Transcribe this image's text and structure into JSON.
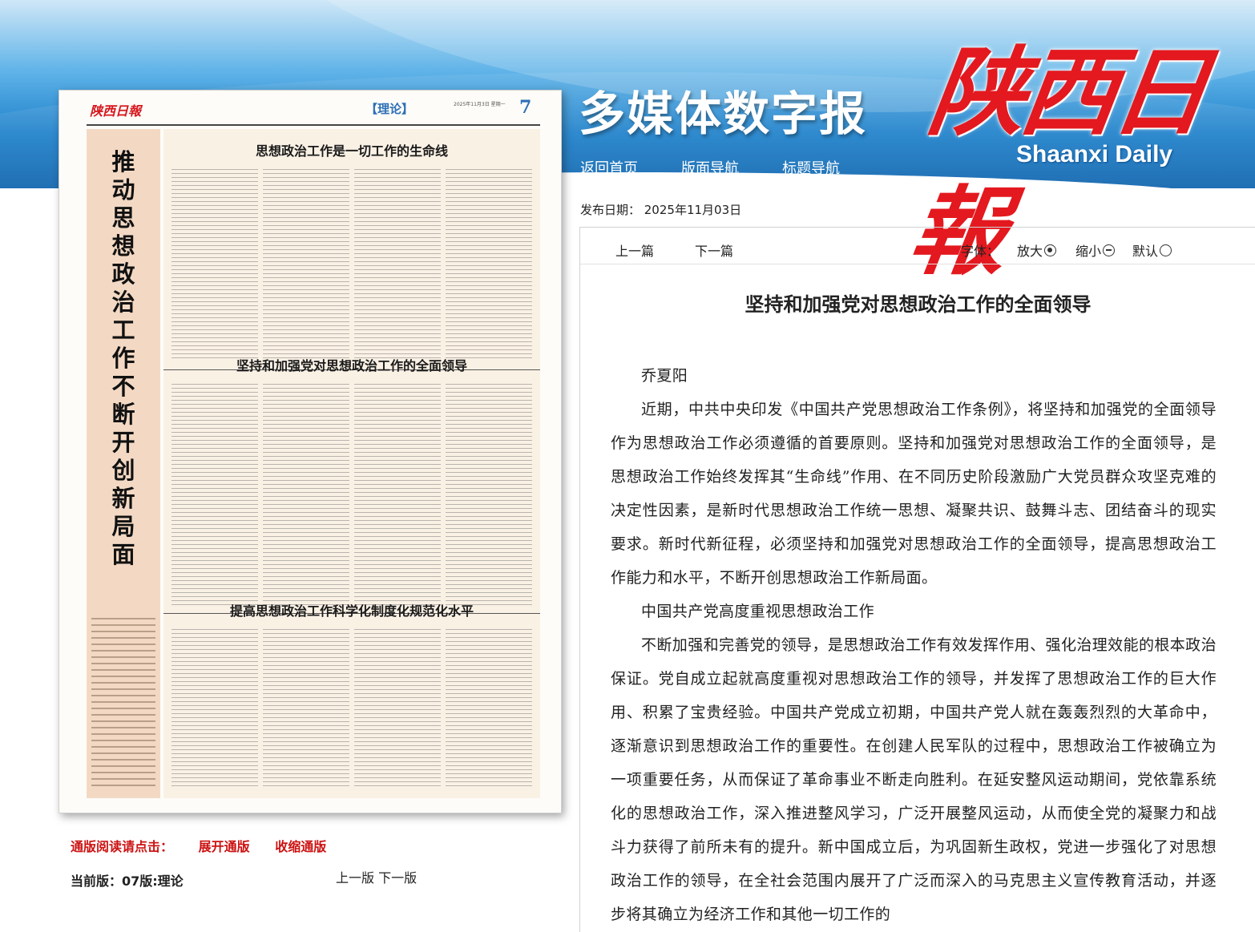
{
  "header": {
    "slogan": "多媒体数字报",
    "logo_cn": "陕西日報",
    "logo_en": "Shaanxi Daily",
    "nav": [
      "返回首页",
      "版面导航",
      "标题导航"
    ]
  },
  "newspaper_page": {
    "brand": "陕西日報",
    "section": "【理论】",
    "date_line": "2025年11月3日 星期一",
    "page_number": "7",
    "side_title": "推动思想政治工作不断开创新局面",
    "headlines": [
      "思想政治工作是一切工作的生命线",
      "坚持和加强党对思想政治工作的全面领导",
      "提高思想政治工作科学化制度化规范化水平"
    ]
  },
  "left_links": {
    "read_label": "通版阅读请点击：",
    "expand": "展开通版",
    "collapse": "收缩通版",
    "current_edition": "当前版：07版:理论",
    "prev_edition": "上一版",
    "next_edition": "下一版"
  },
  "article": {
    "publish_date": "发布日期：  2025年11月03日",
    "prev": "上一篇",
    "next": "下一篇",
    "font_label": "字体：",
    "font_bigger": "放大",
    "font_smaller": "缩小",
    "font_default": "默认",
    "title": "坚持和加强党对思想政治工作的全面领导",
    "author": "乔夏阳",
    "para1": "近期，中共中央印发《中国共产党思想政治工作条例》，将坚持和加强党的全面领导作为思想政治工作必须遵循的首要原则。坚持和加强党对思想政治工作的全面领导，是思想政治工作始终发挥其“生命线”作用、在不同历史阶段激励广大党员群众攻坚克难的决定性因素，是新时代思想政治工作统一思想、凝聚共识、鼓舞斗志、团结奋斗的现实要求。新时代新征程，必须坚持和加强党对思想政治工作的全面领导，提高思想政治工作能力和水平，不断开创思想政治工作新局面。",
    "subhead": "中国共产党高度重视思想政治工作",
    "para2": "不断加强和完善党的领导，是思想政治工作有效发挥作用、强化治理效能的根本政治保证。党自成立起就高度重视对思想政治工作的领导，并发挥了思想政治工作的巨大作用、积累了宝贵经验。中国共产党成立初期，中国共产党人就在轰轰烈烈的大革命中，逐渐意识到思想政治工作的重要性。在创建人民军队的过程中，思想政治工作被确立为一项重要任务，从而保证了革命事业不断走向胜利。在延安整风运动期间，党依靠系统化的思想政治工作，深入推进整风学习，广泛开展整风运动，从而使全党的凝聚力和战斗力获得了前所未有的提升。新中国成立后，为巩固新生政权，党进一步强化了对思想政治工作的领导，在全社会范围内展开了广泛而深入的马克思主义宣传教育活动，并逐步将其确立为经济工作和其他一切工作的"
  }
}
